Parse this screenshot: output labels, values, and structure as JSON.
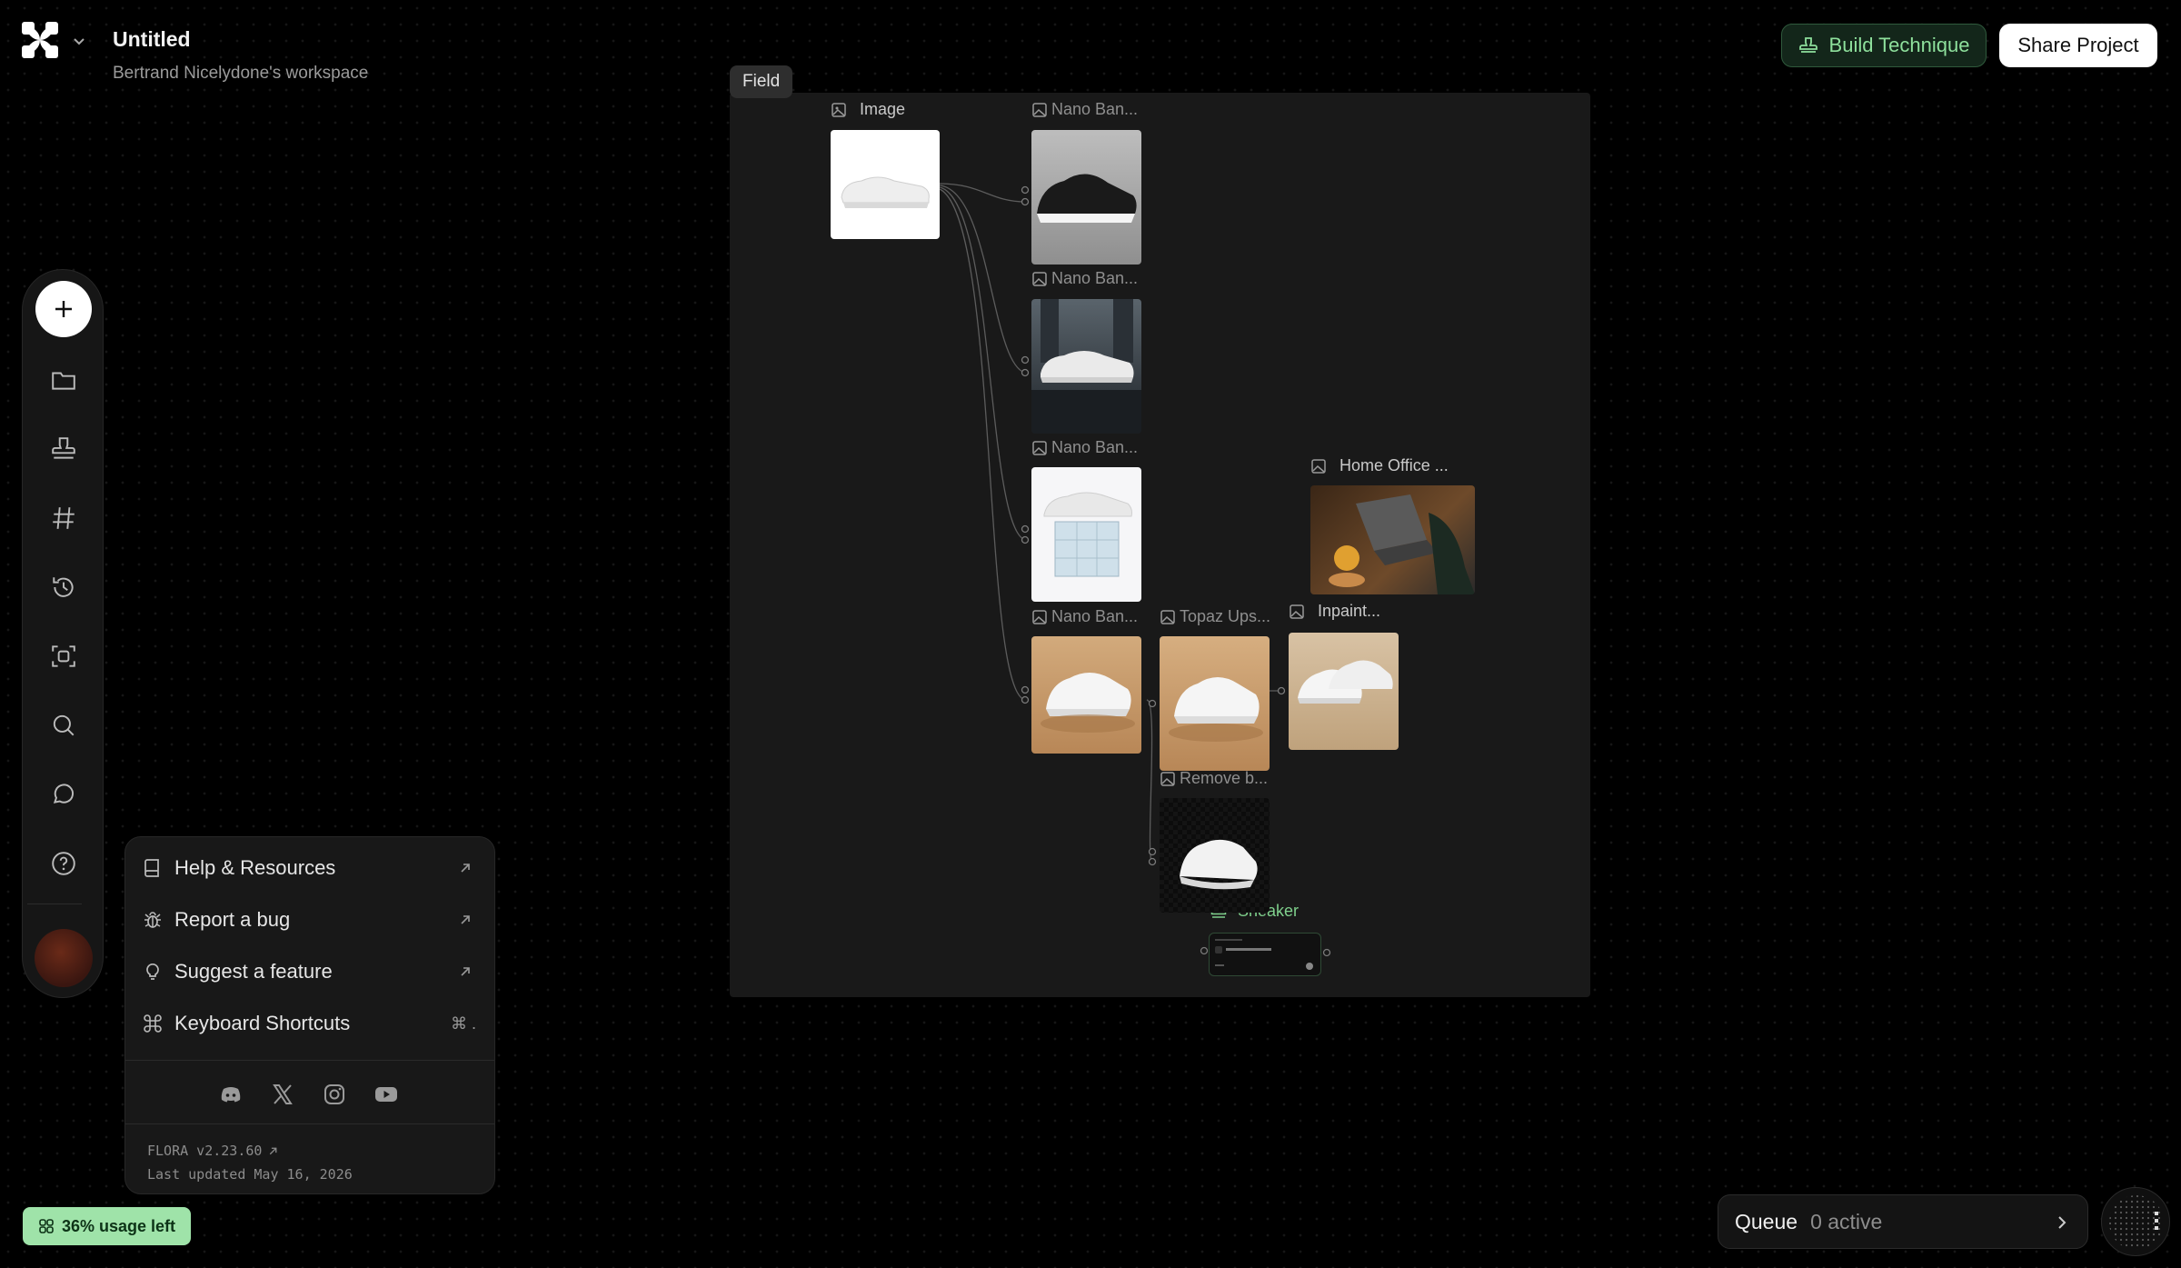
{
  "header": {
    "project_title": "Untitled",
    "workspace": "Bertrand Nicelydone's workspace",
    "build_label": "Build Technique",
    "share_label": "Share Project"
  },
  "toolbar": {
    "items": [
      "add",
      "folder",
      "stamp",
      "hashtag",
      "history",
      "scan",
      "search",
      "chat",
      "help"
    ]
  },
  "help_menu": {
    "items": [
      {
        "label": "Help & Resources",
        "icon": "book-icon",
        "trailing": "external-arrow"
      },
      {
        "label": "Report a bug",
        "icon": "bug-icon",
        "trailing": "external-arrow"
      },
      {
        "label": "Suggest a feature",
        "icon": "lightbulb-icon",
        "trailing": "external-arrow"
      },
      {
        "label": "Keyboard Shortcuts",
        "icon": "command-icon",
        "trailing": "⌘ ."
      }
    ],
    "socials": [
      "discord",
      "x",
      "instagram",
      "youtube"
    ],
    "version": "FLORA v2.23.60",
    "updated": "Last updated May 16, 2026"
  },
  "usage": {
    "label": "36% usage left",
    "percent_left": 36,
    "color": "#9fe3a9"
  },
  "queue": {
    "label": "Queue",
    "count": "0 active"
  },
  "canvas": {
    "field_label": "Field",
    "nodes": {
      "image": "Image",
      "nano1": "Nano Ban...",
      "nano2": "Nano Ban...",
      "nano3": "Nano Ban...",
      "nano4": "Nano Ban...",
      "topaz": "Topaz Ups...",
      "inpaint": "Inpaint...",
      "home_office": "Home Office ...",
      "remove_bg": "Remove b...",
      "sneaker": "Sneaker"
    }
  },
  "colors": {
    "accent_green": "#8ee09c",
    "background": "#000000",
    "panel": "#191919"
  }
}
